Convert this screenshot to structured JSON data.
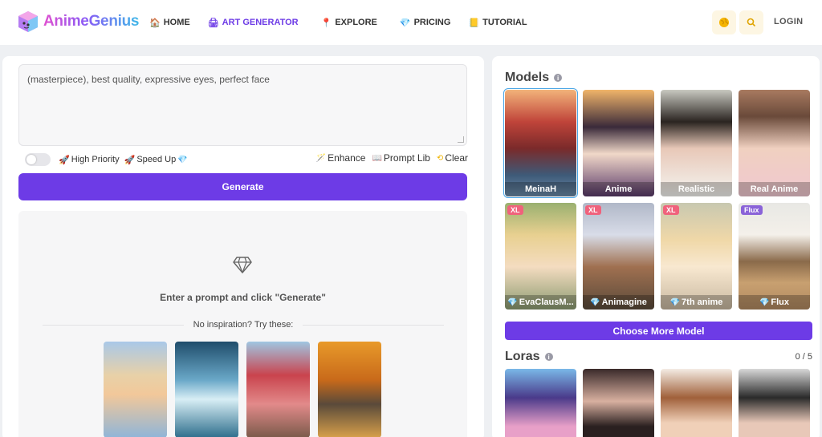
{
  "header": {
    "logo_text": "AnimeGenius",
    "nav": [
      {
        "label": "HOME",
        "icon": "home-icon"
      },
      {
        "label": "ART GENERATOR",
        "icon": "palette-icon"
      },
      {
        "label": "EXPLORE",
        "icon": "pin-icon"
      },
      {
        "label": "PRICING",
        "icon": "gem-icon"
      },
      {
        "label": "TUTORIAL",
        "icon": "book-icon"
      }
    ],
    "login_label": "LOGIN"
  },
  "generator": {
    "prompt_value": "(masterpiece), best quality, expressive eyes, perfect face",
    "high_priority_label": "High Priority",
    "speed_up_label": "Speed Up",
    "enhance_label": "Enhance",
    "prompt_lib_label": "Prompt Lib",
    "clear_label": "Clear",
    "generate_label": "Generate",
    "hint_text": "Enter a prompt and click \"Generate\"",
    "inspiration_text": "No inspiration? Try these:"
  },
  "models_section": {
    "title": "Models",
    "models": [
      {
        "label": "MeinaH",
        "badge": "",
        "gem": false,
        "selected": true
      },
      {
        "label": "Anime",
        "badge": "",
        "gem": false,
        "selected": false
      },
      {
        "label": "Realistic",
        "badge": "",
        "gem": false,
        "selected": false
      },
      {
        "label": "Real Anime",
        "badge": "",
        "gem": false,
        "selected": false
      },
      {
        "label": "EvaClausM...",
        "badge": "XL",
        "gem": true,
        "selected": false
      },
      {
        "label": "Animagine",
        "badge": "XL",
        "gem": true,
        "selected": false
      },
      {
        "label": "7th anime",
        "badge": "XL",
        "gem": true,
        "selected": false
      },
      {
        "label": "Flux",
        "badge": "Flux",
        "gem": true,
        "selected": false
      }
    ],
    "choose_more_label": "Choose More Model"
  },
  "loras_section": {
    "title": "Loras",
    "count": "0 / 5"
  },
  "colors": {
    "accent": "#6d3be6",
    "gem": "#f0b400",
    "badge_xl": "#f0627c",
    "badge_flux": "#8a63d8"
  }
}
